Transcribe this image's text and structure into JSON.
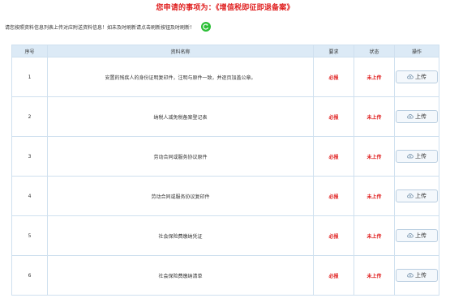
{
  "header": {
    "title": "您申请的事项为：《增值税即征即退备案》"
  },
  "notice": {
    "text": "请您按照资料信息列表上传对应附送资料信息！如未及时刷新请点击刷新按钮及时刷新！"
  },
  "table": {
    "columns": [
      "序号",
      "资料名称",
      "要求",
      "状态",
      "操作"
    ],
    "rows": [
      {
        "no": "1",
        "name": "安置的残疾人的身份证明复印件，注明与原件一致，并逐页加盖公章。",
        "requirement": "必报",
        "status": "未上传",
        "action": "上传"
      },
      {
        "no": "2",
        "name": "纳税人减免税备案登记表",
        "requirement": "必报",
        "status": "未上传",
        "action": "上传"
      },
      {
        "no": "3",
        "name": "劳动合同或服务协议原件",
        "requirement": "必报",
        "status": "未上传",
        "action": "上传"
      },
      {
        "no": "4",
        "name": "劳动合同或服务协议复印件",
        "requirement": "必报",
        "status": "未上传",
        "action": "上传"
      },
      {
        "no": "5",
        "name": "社会保险费缴纳凭证",
        "requirement": "必报",
        "status": "未上传",
        "action": "上传"
      },
      {
        "no": "6",
        "name": "社会保险费缴纳清单",
        "requirement": "必报",
        "status": "未上传",
        "action": "上传"
      }
    ]
  },
  "colors": {
    "title": "#e02020",
    "refresh": "#2cbf37",
    "header_bg": "#dceaf6",
    "border": "#cfe0ef",
    "alert": "#e02020"
  },
  "icons": {
    "refresh": "refresh-icon",
    "upload": "cloud-upload-icon"
  }
}
